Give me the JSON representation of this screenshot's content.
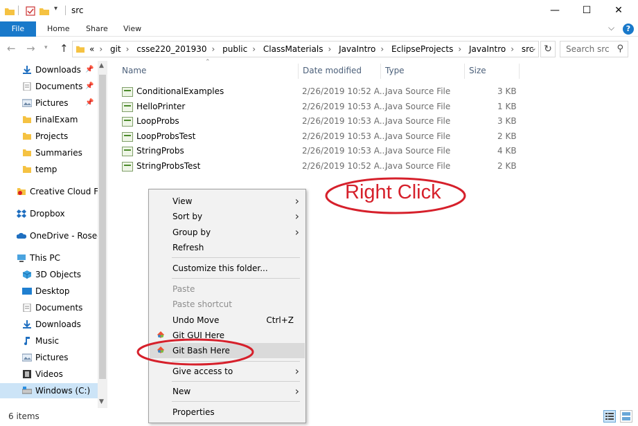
{
  "window": {
    "title": "src",
    "min": "—",
    "max": "☐",
    "close": "✕"
  },
  "ribbon": {
    "tabs": [
      "File",
      "Home",
      "Share",
      "View"
    ],
    "expand_icon": "chevron-down-icon",
    "help": "?"
  },
  "address": {
    "overflow": "«",
    "crumbs": [
      "git",
      "csse220_201930",
      "public",
      "ClassMaterials",
      "JavaIntro",
      "EclipseProjects",
      "JavaIntro",
      "src"
    ],
    "search_placeholder": "Search src"
  },
  "nav": {
    "items": [
      {
        "label": "Downloads",
        "icon": "download-arrow-icon",
        "pinned": true
      },
      {
        "label": "Documents",
        "icon": "document-icon",
        "pinned": true
      },
      {
        "label": "Pictures",
        "icon": "pictures-icon",
        "pinned": true
      },
      {
        "label": "FinalExam",
        "icon": "folder-icon",
        "pinned": false
      },
      {
        "label": "Projects",
        "icon": "folder-icon",
        "pinned": false
      },
      {
        "label": "Summaries",
        "icon": "folder-icon",
        "pinned": false
      },
      {
        "label": "temp",
        "icon": "folder-icon",
        "pinned": false
      },
      {
        "label": "Creative Cloud Files",
        "icon": "creative-cloud-icon",
        "pinned": false
      },
      {
        "label": "Dropbox",
        "icon": "dropbox-icon",
        "pinned": false
      },
      {
        "label": "OneDrive - Rose-Hulman",
        "icon": "onedrive-icon",
        "pinned": false
      },
      {
        "label": "This PC",
        "icon": "computer-icon",
        "pinned": false
      },
      {
        "label": "3D Objects",
        "icon": "cube-icon",
        "pinned": false
      },
      {
        "label": "Desktop",
        "icon": "desktop-icon",
        "pinned": false
      },
      {
        "label": "Documents",
        "icon": "document-icon",
        "pinned": false
      },
      {
        "label": "Downloads",
        "icon": "download-arrow-icon",
        "pinned": false
      },
      {
        "label": "Music",
        "icon": "music-note-icon",
        "pinned": false
      },
      {
        "label": "Pictures",
        "icon": "pictures-icon",
        "pinned": false
      },
      {
        "label": "Videos",
        "icon": "video-icon",
        "pinned": false
      },
      {
        "label": "Windows (C:)",
        "icon": "drive-icon",
        "pinned": false
      }
    ]
  },
  "columns": {
    "name": "Name",
    "date": "Date modified",
    "type": "Type",
    "size": "Size"
  },
  "files": [
    {
      "name": "ConditionalExamples",
      "date": "2/26/2019 10:52 A...",
      "type": "Java Source File",
      "size": "3 KB"
    },
    {
      "name": "HelloPrinter",
      "date": "2/26/2019 10:53 A...",
      "type": "Java Source File",
      "size": "1 KB"
    },
    {
      "name": "LoopProbs",
      "date": "2/26/2019 10:53 A...",
      "type": "Java Source File",
      "size": "3 KB"
    },
    {
      "name": "LoopProbsTest",
      "date": "2/26/2019 10:53 A...",
      "type": "Java Source File",
      "size": "2 KB"
    },
    {
      "name": "StringProbs",
      "date": "2/26/2019 10:53 A...",
      "type": "Java Source File",
      "size": "4 KB"
    },
    {
      "name": "StringProbsTest",
      "date": "2/26/2019 10:52 A...",
      "type": "Java Source File",
      "size": "2 KB"
    }
  ],
  "context_menu": {
    "view": "View",
    "sort_by": "Sort by",
    "group_by": "Group by",
    "refresh": "Refresh",
    "customize": "Customize this folder...",
    "paste": "Paste",
    "paste_shortcut": "Paste shortcut",
    "undo_move": "Undo Move",
    "undo_shortcut": "Ctrl+Z",
    "git_gui": "Git GUI Here",
    "git_bash": "Git Bash Here",
    "give_access": "Give access to",
    "new": "New",
    "properties": "Properties"
  },
  "annotation": {
    "text": "Right Click",
    "color": "#d6202b"
  },
  "status": {
    "items": "6 items"
  },
  "colors": {
    "accent": "#1979ca",
    "selection": "#cce4f7",
    "annotation": "#d6202b"
  }
}
